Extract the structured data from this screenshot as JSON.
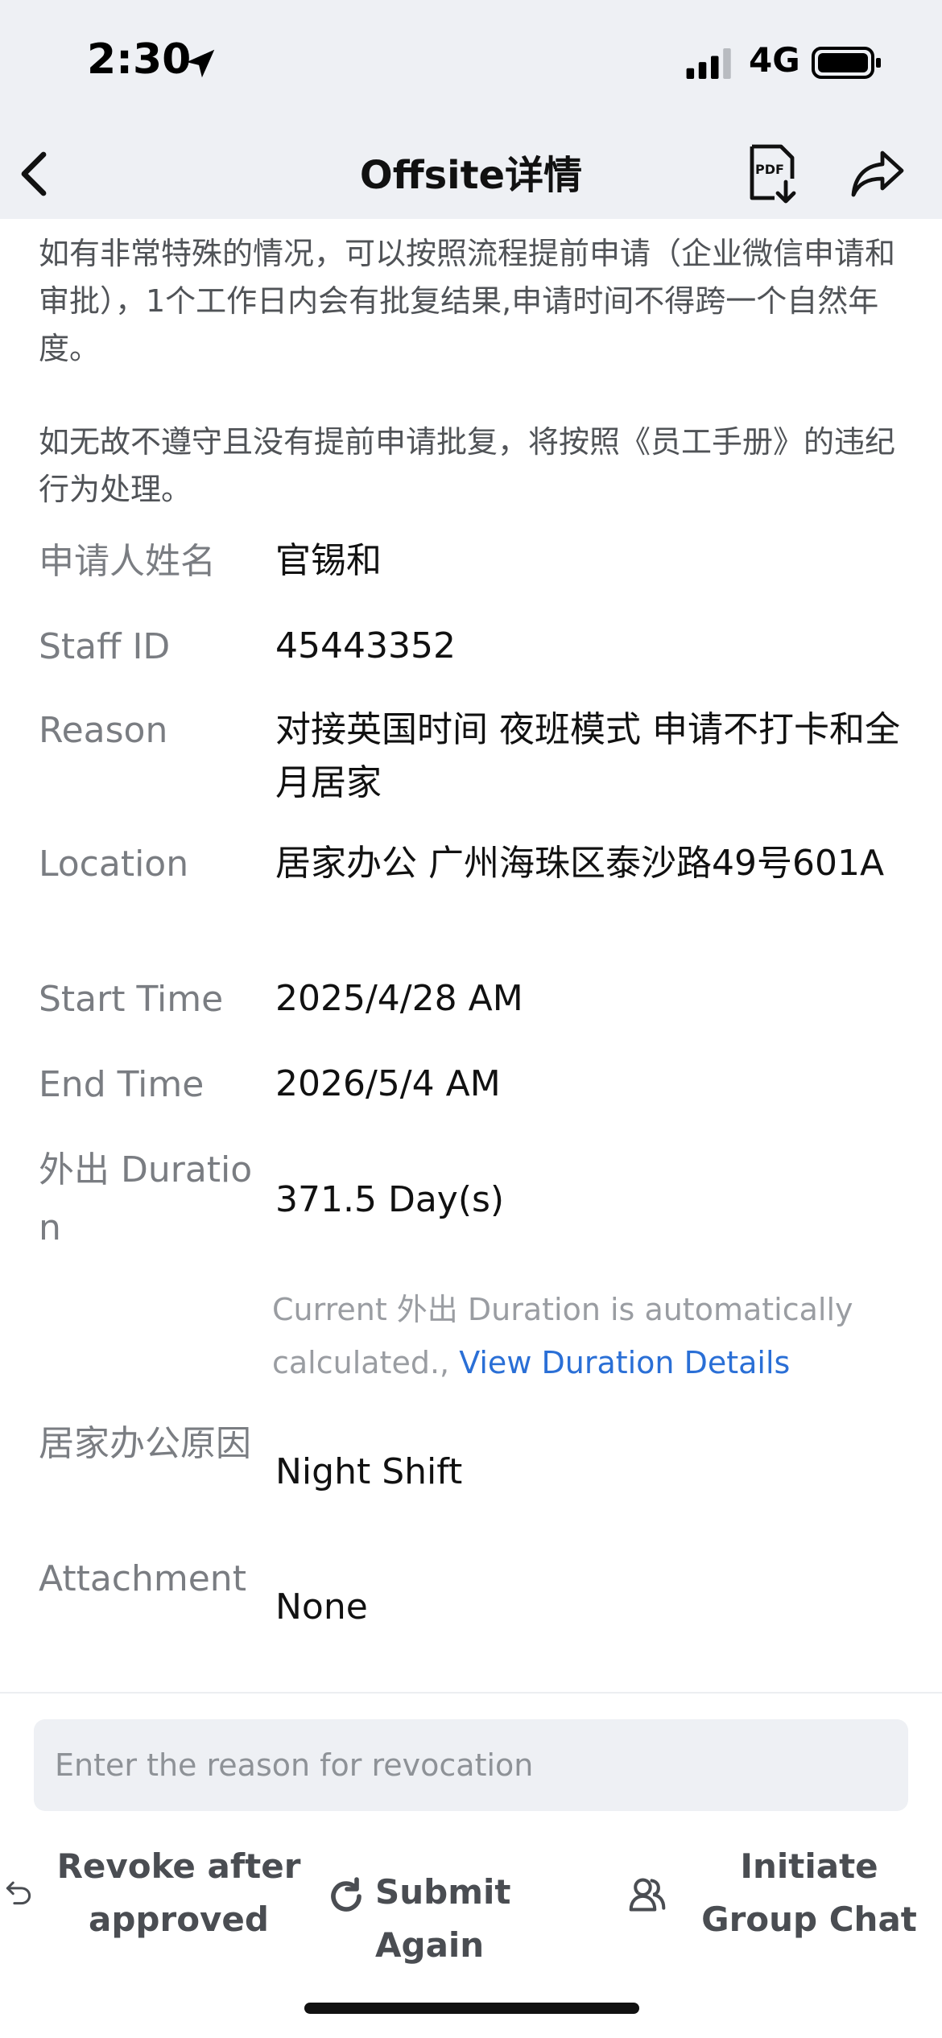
{
  "status_bar": {
    "time": "2:30",
    "network": "4G",
    "icons": [
      "location-arrow-icon",
      "signal-icon",
      "battery-icon"
    ]
  },
  "nav": {
    "title": "Offsite详情",
    "icons": [
      "back-icon",
      "pdf-download-icon",
      "share-icon"
    ]
  },
  "notices": [
    "如有非常特殊的情况，可以按照流程提前申请（企业微信申请和审批），1个工作日内会有批复结果,申请时间不得跨一个自然年度。",
    "如无故不遵守且没有提前申请批复，将按照《员工手册》的违纪行为处理。"
  ],
  "details": [
    {
      "label": "申请人姓名",
      "value": "官锡和"
    },
    {
      "label": "Staff ID",
      "value": "45443352"
    },
    {
      "label": "Reason",
      "value": "对接英国时间 夜班模式 申请不打卡和全月居家"
    },
    {
      "label": "Location",
      "value": "居家办公 广州海珠区泰沙路49号601A"
    },
    {
      "label": "Start Time",
      "value": "2025/4/28 AM"
    },
    {
      "label": "End Time",
      "value": "2026/5/4 AM"
    },
    {
      "label": "外出 Duration",
      "value": "371.5 Day(s)"
    },
    {
      "label": "居家办公原因",
      "value": "Night Shift"
    },
    {
      "label": "Attachment",
      "value": "None"
    }
  ],
  "duration_hint": {
    "text": "Current 外出 Duration is automatically calculated.,",
    "link": "View Duration Details"
  },
  "revoke_reason": {
    "placeholder": "Enter the reason for revocation",
    "value": ""
  },
  "actions": {
    "revoke": "Revoke after approved",
    "submit_again": "Submit Again",
    "group_chat": "Initiate Group Chat"
  },
  "colors": {
    "header_bg": "#eef0f4",
    "label": "#7a7d82",
    "link": "#2a6fd6",
    "hint": "#9a9da2"
  }
}
